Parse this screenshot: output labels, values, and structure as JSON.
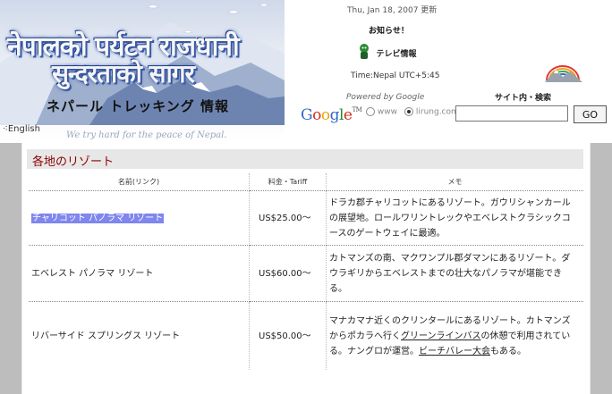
{
  "header": {
    "banner": {
      "nepali_line1": "नेपालको पर्यटन राजधानी",
      "nepali_line2": "सुन्दरताको सागर",
      "title": "ネパール トレッキング 情報",
      "tagline": "We try hard for the peace of Nepal."
    },
    "english_link": "English",
    "date": "Thu, Jan 18, 2007 更新",
    "notice": "お知らせ！",
    "tv_info": "テレビ情報",
    "time": "Time:Nepal UTC+5:45",
    "powered_by": "Powered by Google",
    "site_search_label": "サイト内・検索",
    "search": {
      "logo": "Google",
      "tm": "TM",
      "options": [
        "www",
        "lirung.com"
      ],
      "selected": "lirung.com",
      "query": "",
      "go_label": "GO"
    },
    "colors": {
      "google_blue": "#3366cc",
      "google_red": "#d62d20",
      "google_yellow": "#e8a500",
      "google_green": "#1e8f2e"
    }
  },
  "main": {
    "section_title": "各地のリゾート",
    "accent_color": "#8a0000",
    "table": {
      "headers": [
        "名前(リンク)",
        "料金・Tariff",
        "メモ"
      ],
      "rows": [
        {
          "name": "チャリコット パノラマ リゾート",
          "price": "US$25.00～",
          "memo": "ドラカ郡チャリコットにあるリゾート。ガウリシャンカールの展望地。ロールワリントレックやエベレストクラシックコースのゲートウェイに最適。",
          "highlighted": true
        },
        {
          "name": "エベレスト パノラマ リゾート",
          "price": "US$60.00～",
          "memo": "カトマンズの南、マクワンプル郡ダマンにあるリゾート。ダウラギリからエベレストまでの壮大なパノラマが堪能できる。"
        },
        {
          "name": "リバーサイド スプリングス リゾート",
          "price": "US$50.00～",
          "memo_a": "マナカマナ近くのクリンタールにあるリゾート。カトマンズからポカラへ行く",
          "memo_link1": "グリーンラインバス",
          "memo_b": "の休憩で利用されている。ナングロが運営。",
          "memo_link2": "ビーチバレー大会",
          "memo_c": "もある。"
        }
      ]
    }
  }
}
